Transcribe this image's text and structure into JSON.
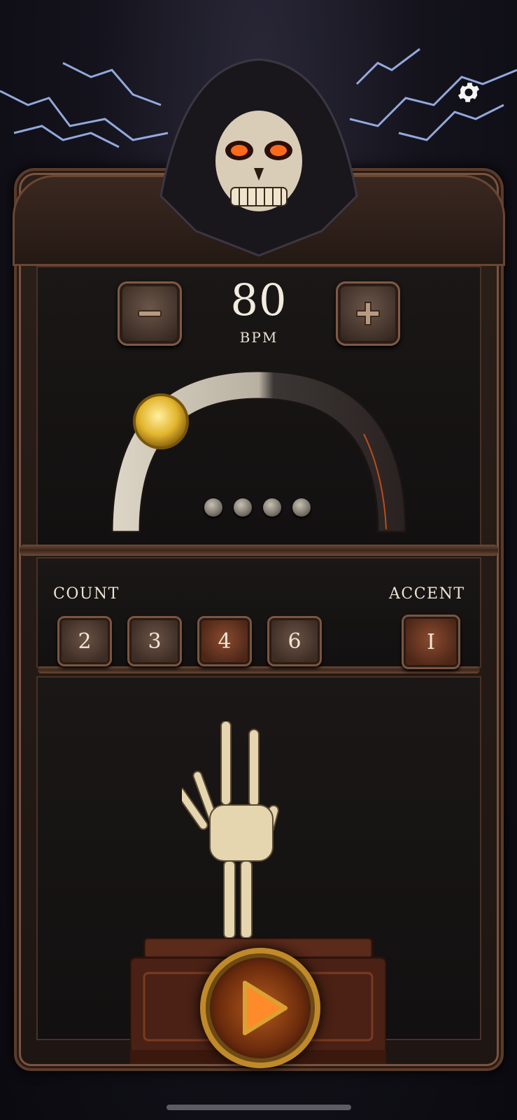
{
  "tempo": {
    "bpm_value": "80",
    "bpm_label": "BPM",
    "decrease_icon": "minus-icon",
    "increase_icon": "plus-icon"
  },
  "settings": {
    "icon": "gear-icon"
  },
  "beats": {
    "count": 4
  },
  "count_section": {
    "label": "COUNT",
    "options": [
      "2",
      "3",
      "4",
      "6"
    ],
    "selected": "4"
  },
  "accent_section": {
    "label": "ACCENT",
    "value": "I"
  },
  "transport": {
    "play_icon": "play-icon"
  },
  "colors": {
    "background": "#0c0b12",
    "frame": "#5a3b2b",
    "gold": "#c08a2a",
    "ember": "#b35a1d"
  }
}
